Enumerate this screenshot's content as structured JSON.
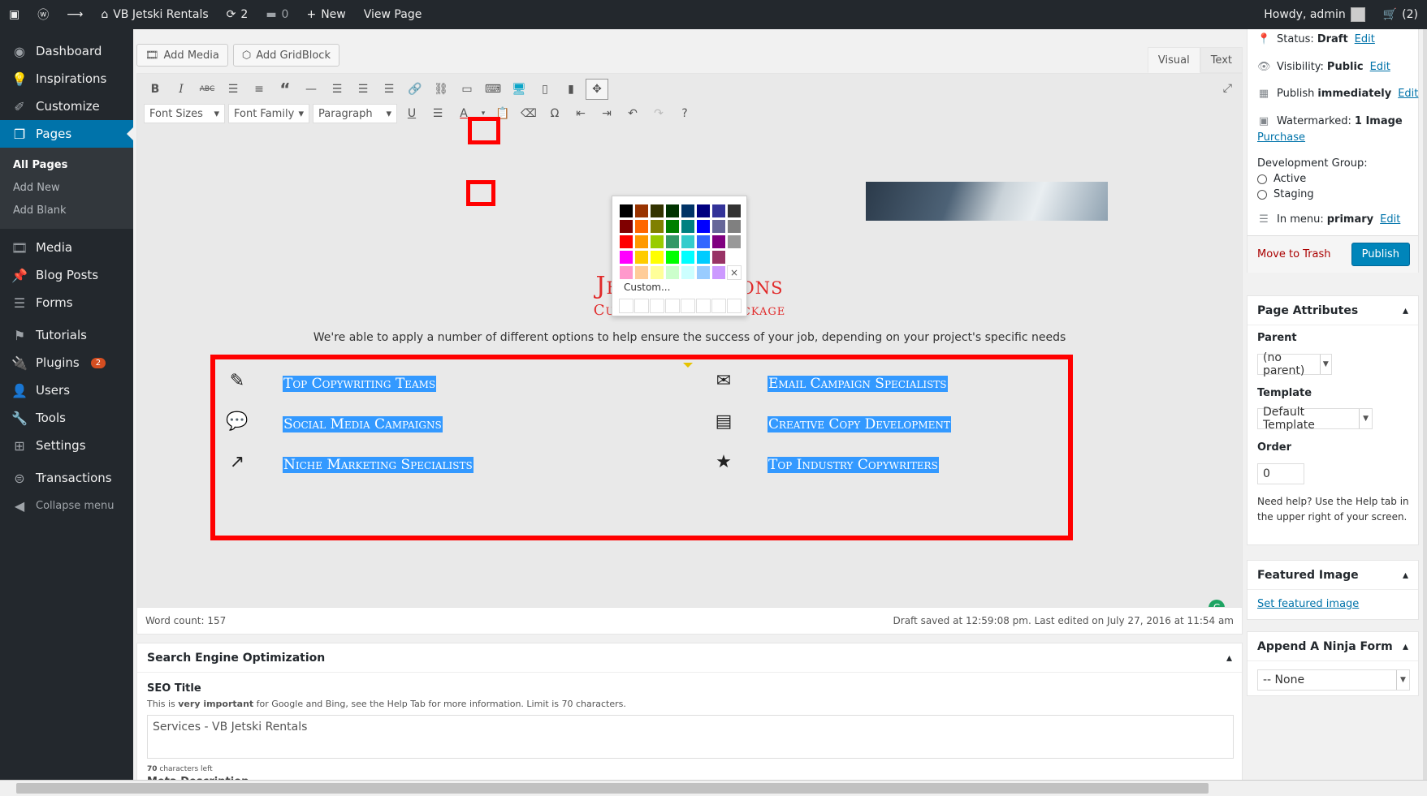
{
  "adminbar": {
    "site_name": "VB Jetski Rentals",
    "updates_count": "2",
    "comments_count": "0",
    "new_label": "New",
    "view_page_label": "View Page",
    "howdy": "Howdy, admin",
    "cart_count": "(2)"
  },
  "sidebar": {
    "items": [
      {
        "label": "Dashboard"
      },
      {
        "label": "Inspirations"
      },
      {
        "label": "Customize"
      },
      {
        "label": "Pages"
      },
      {
        "label": "Media"
      },
      {
        "label": "Blog Posts"
      },
      {
        "label": "Forms"
      },
      {
        "label": "Tutorials"
      },
      {
        "label": "Plugins"
      },
      {
        "label": "Users"
      },
      {
        "label": "Tools"
      },
      {
        "label": "Settings"
      },
      {
        "label": "Transactions"
      }
    ],
    "plugins_badge": "2",
    "submenu": [
      "All Pages",
      "Add New",
      "Add Blank"
    ],
    "collapse_label": "Collapse menu"
  },
  "editor": {
    "add_media_label": "Add Media",
    "add_gridblock_label": "Add GridBlock",
    "tab_visual": "Visual",
    "tab_text": "Text",
    "font_sizes": "Font Sizes",
    "font_family": "Font Family",
    "paragraph": "Paragraph"
  },
  "colorpicker": {
    "colors": [
      "#000000",
      "#993300",
      "#333300",
      "#003300",
      "#003366",
      "#000080",
      "#333399",
      "#333333",
      "#800000",
      "#ff6600",
      "#808000",
      "#008000",
      "#008080",
      "#0000ff",
      "#666699",
      "#808080",
      "#ff0000",
      "#ff9900",
      "#99cc00",
      "#339966",
      "#33cccc",
      "#3366ff",
      "#800080",
      "#999999",
      "#ff00ff",
      "#ffcc00",
      "#ffff00",
      "#00ff00",
      "#00ffff",
      "#00ccff",
      "#993366",
      "#ffffff",
      "#ff99cc",
      "#ffcc99",
      "#ffff99",
      "#ccffcc",
      "#ccffff",
      "#99ccff",
      "#cc99ff"
    ],
    "remove_glyph": "×",
    "custom_label": "Custom..."
  },
  "content": {
    "title": "Jet Ski Options",
    "subtitle": "Customize Your Package",
    "intro": "We're able to apply a number of different options to help ensure the success of your job, depending on your project's specific needs",
    "features": [
      {
        "icon": "edit-icon",
        "glyph": "✎",
        "text": "Top Copywriting Teams"
      },
      {
        "icon": "envelope-icon",
        "glyph": "✉",
        "text": "Email Campaign Specialists"
      },
      {
        "icon": "comments-icon",
        "glyph": "💬",
        "text": "Social Media Campaigns"
      },
      {
        "icon": "newspaper-icon",
        "glyph": "▤",
        "text": "Creative Copy Development"
      },
      {
        "icon": "trend-chart-icon",
        "glyph": "↗",
        "text": "Niche Marketing Specialists"
      },
      {
        "icon": "star-icon",
        "glyph": "★",
        "text": "Top Industry Copywriters"
      }
    ]
  },
  "status_bar": {
    "word_count": "Word count: 157",
    "draft_saved": "Draft saved at 12:59:08 pm. Last edited on July 27, 2016 at 11:54 am"
  },
  "seo": {
    "heading": "Search Engine Optimization",
    "title_label": "SEO Title",
    "help_before": "This is ",
    "help_bold": "very important",
    "help_after": " for Google and Bing, see the Help Tab for more information. Limit is 70 characters.",
    "title_value": "Services - VB Jetski Rentals",
    "chars_left_num": "70",
    "chars_left_text": " characters left",
    "next_label": "Meta Description"
  },
  "publish": {
    "status_label": "Status:",
    "status_value": "Draft",
    "visibility_label": "Visibility:",
    "visibility_value": "Public",
    "publish_label": "Publish",
    "publish_value": "immediately",
    "watermarked_label": "Watermarked:",
    "watermarked_value": "1 Image",
    "purchase": "Purchase",
    "edit": "Edit",
    "dev_group_label": "Development Group:",
    "dev_active": "Active",
    "dev_staging": "Staging",
    "menu_label": "In menu:",
    "menu_value": "primary",
    "trash": "Move to Trash",
    "publish_button": "Publish"
  },
  "page_attributes": {
    "heading": "Page Attributes",
    "parent_label": "Parent",
    "parent_value": "(no parent)",
    "template_label": "Template",
    "template_value": "Default Template",
    "order_label": "Order",
    "order_value": "0",
    "help": "Need help? Use the Help tab in the upper right of your screen."
  },
  "featured_image": {
    "heading": "Featured Image",
    "link": "Set featured image"
  },
  "ninja_form": {
    "heading": "Append A Ninja Form",
    "value": "-- None"
  }
}
